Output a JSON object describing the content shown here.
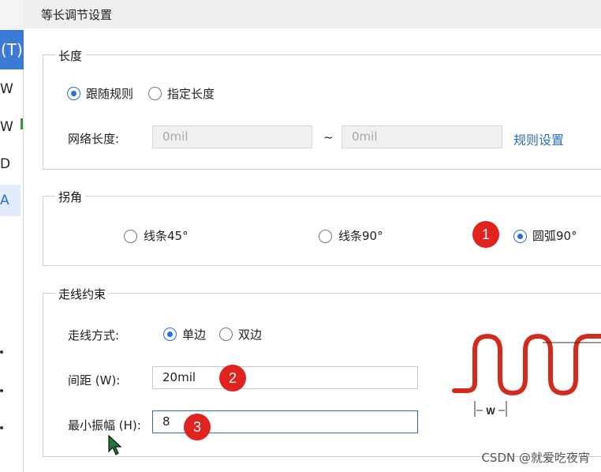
{
  "background_window": {
    "tab_label": "(T)",
    "letters": [
      "W",
      "W",
      "D",
      "A"
    ]
  },
  "dialog": {
    "title": "等长调节设置",
    "length_group": {
      "label": "长度",
      "radio_follow_rule": "跟随规则",
      "radio_specify_length": "指定长度",
      "selected": "跟随规则",
      "net_length_label": "网络长度:",
      "min_placeholder": "0mil",
      "range_sep": "~",
      "max_placeholder": "0mil",
      "rule_link": "规则设置"
    },
    "corner_group": {
      "label": "拐角",
      "options": [
        "线条45°",
        "线条90°",
        "圆弧90°"
      ],
      "selected": "圆弧90°"
    },
    "routing_group": {
      "label": "走线约束",
      "mode_label": "走线方式:",
      "mode_single": "单边",
      "mode_double": "双边",
      "selected": "单边",
      "spacing_label": "间距 (W):",
      "spacing_value": "20mil",
      "min_amplitude_label": "最小振幅 (H):",
      "min_amplitude_value": "8",
      "diagram_w_label": "W"
    }
  },
  "annotations": [
    "1",
    "2",
    "3"
  ],
  "colors": {
    "accent": "#2a6fd1",
    "badge": "#e0231f",
    "trace": "#d42a1c"
  },
  "watermark": "CSDN @就爱吃夜宵"
}
